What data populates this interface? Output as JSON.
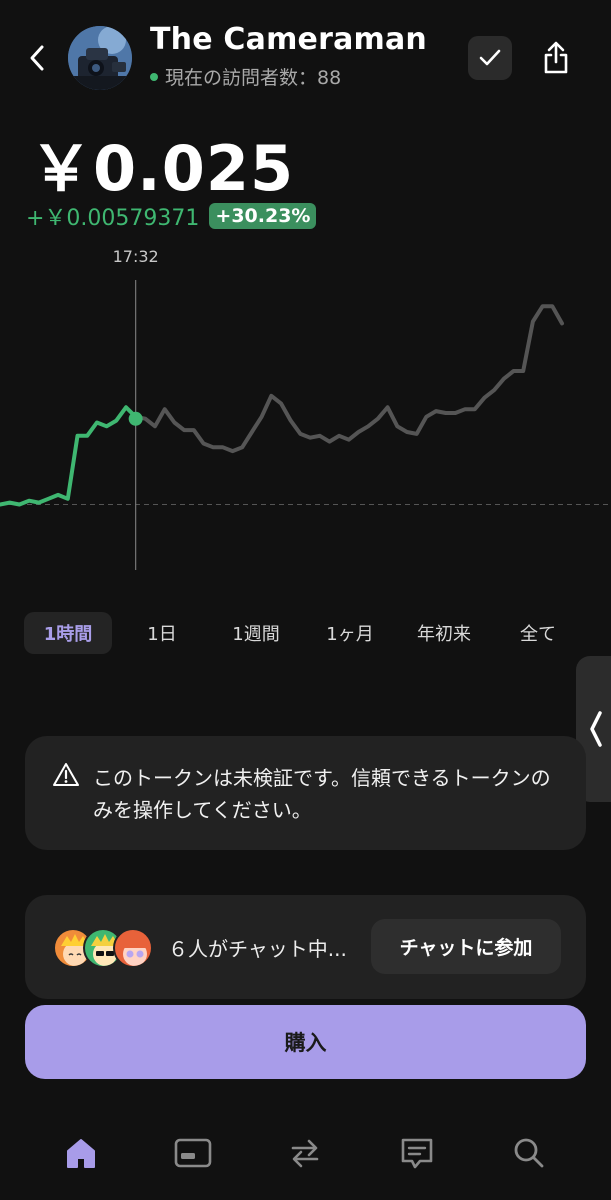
{
  "header": {
    "token_name": "The Cameraman",
    "visitors_label": "現在の訪問者数：88",
    "status_color": "#3fb771"
  },
  "price": {
    "current": "￥0.025",
    "change_abs": "+￥0.00579371",
    "change_pct": "+30.23%"
  },
  "chart": {
    "crosshair_time": "17:32",
    "colors": {
      "up": "#3fb771",
      "rest": "#555555",
      "crosshair": "#777777",
      "baseline": "#555555"
    },
    "highlighted_index": 14,
    "baseline_value": 0.0192,
    "y_range": [
      0.0155,
      0.0315
    ],
    "series": [
      0.0192,
      0.0193,
      0.0192,
      0.0194,
      0.0193,
      0.0195,
      0.0197,
      0.0195,
      0.0228,
      0.0228,
      0.0235,
      0.0233,
      0.0236,
      0.0243,
      0.0238,
      0.0237,
      0.0233,
      0.0242,
      0.0235,
      0.0231,
      0.0231,
      0.0224,
      0.0222,
      0.0222,
      0.022,
      0.0222,
      0.023,
      0.0238,
      0.0249,
      0.0245,
      0.0236,
      0.0229,
      0.0227,
      0.0228,
      0.0225,
      0.0228,
      0.0226,
      0.023,
      0.0233,
      0.0237,
      0.0243,
      0.0233,
      0.023,
      0.0229,
      0.0238,
      0.0241,
      0.024,
      0.024,
      0.0242,
      0.0242,
      0.0248,
      0.0252,
      0.0258,
      0.0262,
      0.0262,
      0.0288,
      0.0296,
      0.0296,
      0.0287
    ]
  },
  "ranges": {
    "tabs": [
      {
        "label": "1時間",
        "active": true
      },
      {
        "label": "1日",
        "active": false
      },
      {
        "label": "1週間",
        "active": false
      },
      {
        "label": "1ヶ月",
        "active": false
      },
      {
        "label": "年初来",
        "active": false
      },
      {
        "label": "全て",
        "active": false
      }
    ]
  },
  "warning": {
    "text": "このトークンは未検証です。信頼できるトークンのみを操作してください。"
  },
  "chat": {
    "text": "６人がチャット中...",
    "join_label": "チャットに参加"
  },
  "buy": {
    "label": "購入",
    "color": "#a89ce9"
  },
  "tabbar": {
    "active_color": "#a89ce9",
    "inactive_color": "#8a8a8a",
    "icons": [
      "home-icon",
      "wallet-icon",
      "swap-icon",
      "chat-icon",
      "search-icon"
    ]
  }
}
